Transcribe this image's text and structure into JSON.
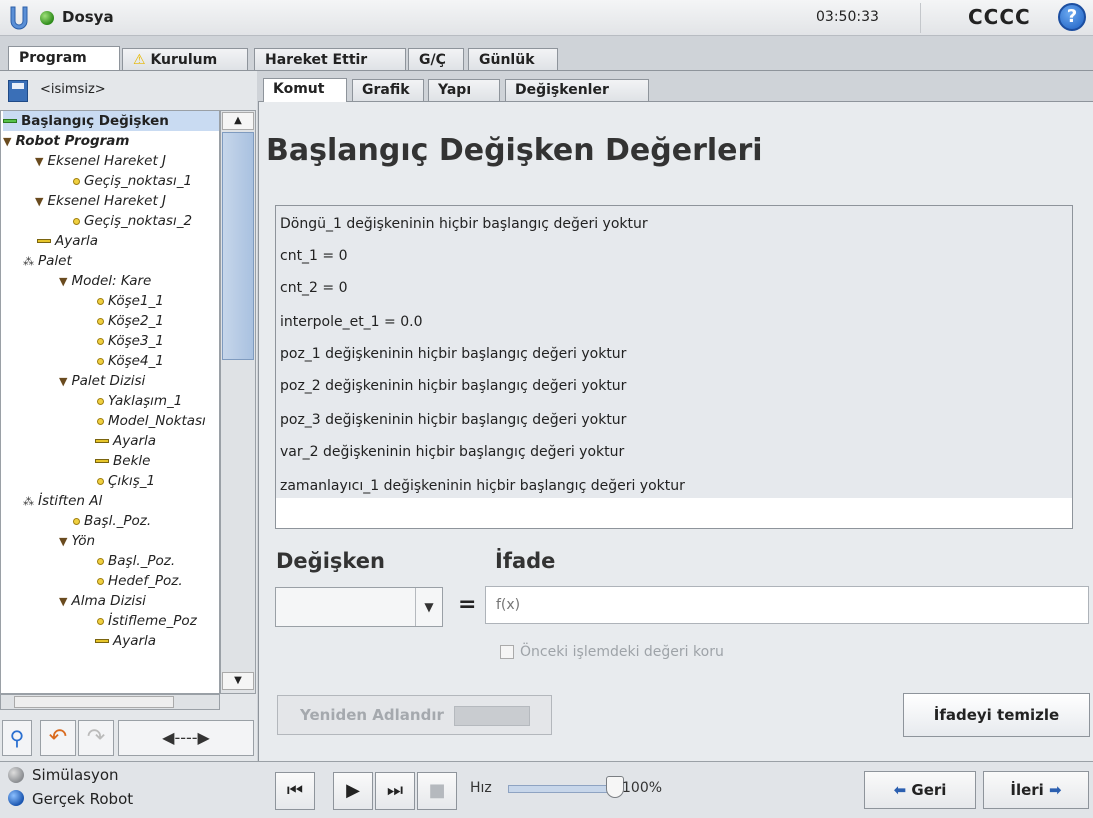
{
  "titlebar": {
    "file_menu": "Dosya",
    "clock": "03:50:33",
    "robot_name": "CCCC",
    "help": "?"
  },
  "top_tabs": [
    "Program",
    "Kurulum",
    "Hareket Ettir",
    "G/Ç",
    "Günlük"
  ],
  "program": {
    "file_name": "<isimsiz>"
  },
  "tree": [
    {
      "label": "Başlangıç Değişken",
      "icon": "bar-green-icon"
    },
    {
      "label": "Robot Program",
      "icon": "triangle-icon"
    },
    {
      "label": "Eksenel Hareket J",
      "icon": "triangle-icon"
    },
    {
      "label": "Geçiş_noktası_1",
      "icon": "waypoint-icon"
    },
    {
      "label": "Eksenel Hareket J",
      "icon": "triangle-icon"
    },
    {
      "label": "Geçiş_noktası_2",
      "icon": "waypoint-icon"
    },
    {
      "label": "Ayarla",
      "icon": "set-icon"
    },
    {
      "label": "Palet",
      "icon": "pallet-icon"
    },
    {
      "label": "Model: Kare",
      "icon": "triangle-icon"
    },
    {
      "label": "Köşe1_1",
      "icon": "waypoint-icon"
    },
    {
      "label": "Köşe2_1",
      "icon": "waypoint-icon"
    },
    {
      "label": "Köşe3_1",
      "icon": "waypoint-icon"
    },
    {
      "label": "Köşe4_1",
      "icon": "waypoint-icon"
    },
    {
      "label": "Palet Dizisi",
      "icon": "triangle-icon"
    },
    {
      "label": "Yaklaşım_1",
      "icon": "waypoint-icon"
    },
    {
      "label": "Model_Noktası",
      "icon": "waypoint-icon"
    },
    {
      "label": "Ayarla",
      "icon": "set-icon"
    },
    {
      "label": "Bekle",
      "icon": "set-icon"
    },
    {
      "label": "Çıkış_1",
      "icon": "waypoint-icon"
    },
    {
      "label": "İstiften Al",
      "icon": "pallet-icon"
    },
    {
      "label": "Başl._Poz.",
      "icon": "waypoint-icon"
    },
    {
      "label": "Yön",
      "icon": "triangle-icon"
    },
    {
      "label": "Başl._Poz.",
      "icon": "waypoint-icon"
    },
    {
      "label": "Hedef_Poz.",
      "icon": "waypoint-icon"
    },
    {
      "label": "Alma Dizisi",
      "icon": "triangle-icon"
    },
    {
      "label": "İstifleme_Poz",
      "icon": "waypoint-icon"
    },
    {
      "label": "Ayarla",
      "icon": "set-icon"
    }
  ],
  "sub_tabs": [
    "Komut",
    "Grafik",
    "Yapı",
    "Değişkenler"
  ],
  "main": {
    "title": "Başlangıç Değişken Değerleri",
    "variables": [
      "Döngü_1 değişkeninin hiçbir başlangıç değeri yoktur",
      "cnt_1 = 0",
      "cnt_2 = 0",
      "interpole_et_1 = 0.0",
      "poz_1 değişkeninin hiçbir başlangıç değeri yoktur",
      "poz_2 değişkeninin hiçbir başlangıç değeri yoktur",
      "poz_3 değişkeninin hiçbir başlangıç değeri yoktur",
      "var_2 değişkeninin hiçbir başlangıç değeri yoktur",
      "zamanlayıcı_1 değişkeninin hiçbir başlangıç değeri yoktur"
    ],
    "label_variable": "Değişken",
    "label_expression": "İfade",
    "equals": "=",
    "expression_placeholder": "f(x)",
    "keep_value_label": "Önceki işlemdeki değeri koru",
    "rename_button": "Yeniden Adlandır",
    "clear_button": "İfadeyi temizle"
  },
  "footer": {
    "simulation": "Simülasyon",
    "real_robot": "Gerçek Robot",
    "speed_label": "Hız",
    "speed_value": "100%",
    "speed_fraction": 1.0,
    "back_button": "Geri",
    "next_button": "İleri"
  },
  "colors": {
    "accent_blue": "#2b5fb0",
    "selection": "#c9dbf2",
    "warning": "#e6b800"
  }
}
